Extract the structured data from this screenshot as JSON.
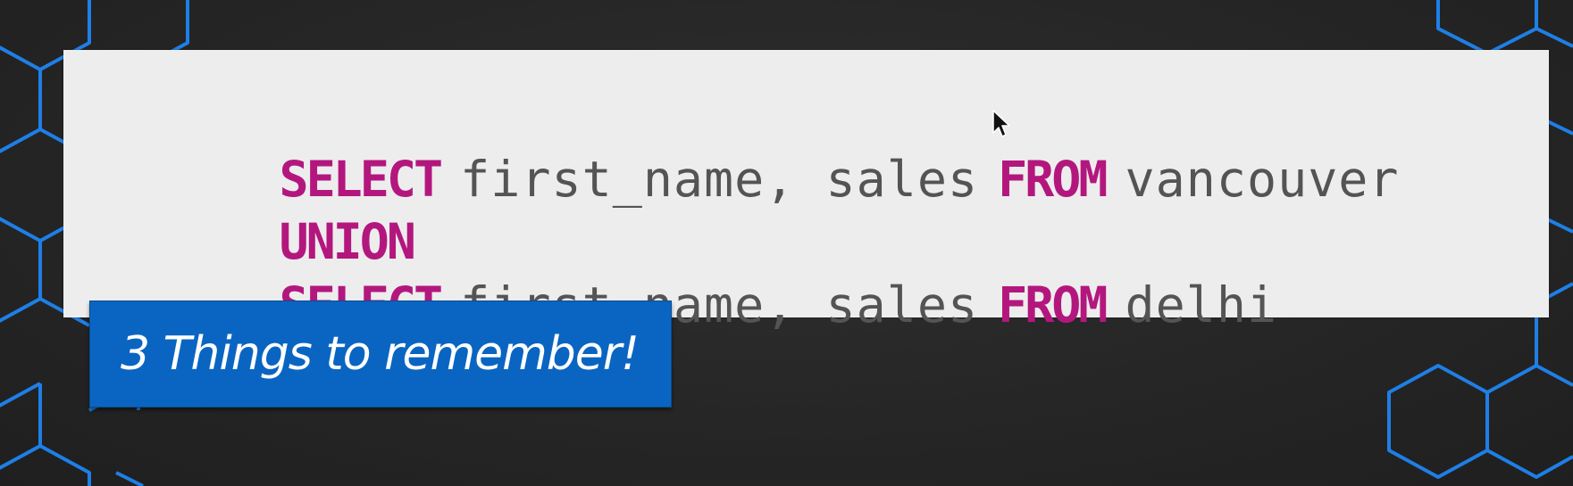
{
  "code": {
    "lines": [
      {
        "kw1": "SELECT",
        "fields": "first_name, sales",
        "kw2": "FROM",
        "table": "vancouver"
      },
      {
        "kw1": "UNION"
      },
      {
        "kw1": "SELECT",
        "fields": "first_name, sales",
        "kw2": "FROM",
        "table": "delhi"
      }
    ]
  },
  "banner": {
    "text": "3 Things to remember!"
  },
  "colors": {
    "keyword": "#b3177e",
    "identifier": "#545454",
    "panel": "#ededed",
    "banner": "#0a65c2",
    "hex_outline": "#1e7fe6",
    "background": "#262626"
  },
  "icons": {
    "cursor": "mouse-pointer-icon",
    "background": "hexagon-pattern"
  }
}
